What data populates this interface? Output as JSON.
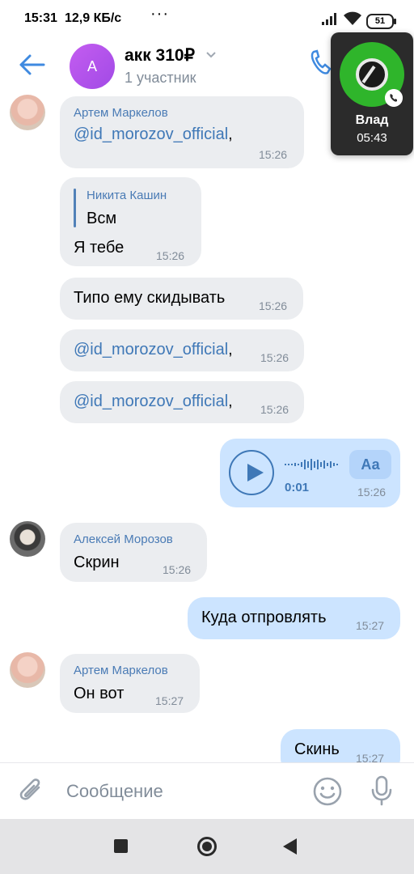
{
  "status": {
    "time": "15:31",
    "net_speed": "12,9 КБ/с",
    "battery": "51"
  },
  "header": {
    "back_icon": "arrow-left-icon",
    "avatar_letter": "А",
    "title": "акк 310₽",
    "subtitle": "1 участник",
    "call_icon": "phone-icon",
    "accent": "#3f8ae0"
  },
  "call_overlay": {
    "name": "Влад",
    "duration": "05:43"
  },
  "messages": [
    {
      "sender": "Артем Маркелов",
      "text": "@id_morozov_official",
      "trail": ",",
      "time": "15:26"
    },
    {
      "reply_to": {
        "name": "Никита Кашин",
        "text": "Всм"
      },
      "text": "Я тебе",
      "time": "15:26"
    },
    {
      "text": "Типо ему скидывать",
      "time": "15:26"
    },
    {
      "text": "@id_morozov_official",
      "trail": ",",
      "time": "15:26"
    },
    {
      "text": "@id_morozov_official",
      "trail": ",",
      "time": "15:26"
    },
    {
      "outgoing": true,
      "voice": {
        "duration": "0:01",
        "transcribe_label": "Аа"
      },
      "time": "15:26"
    },
    {
      "sender": "Алексей Морозов",
      "text": "Скрин",
      "time": "15:26"
    },
    {
      "outgoing": true,
      "text": "Куда отпровлять",
      "time": "15:27"
    },
    {
      "sender": "Артем Маркелов",
      "text": "Он вот",
      "time": "15:27"
    },
    {
      "outgoing": true,
      "text": "Скинь",
      "time": "15:27"
    }
  ],
  "composer": {
    "placeholder": "Сообщение",
    "attach_icon": "paperclip-icon",
    "emoji_icon": "smile-icon",
    "mic_icon": "microphone-icon"
  },
  "colors": {
    "incoming_bubble": "#ebedf0",
    "outgoing_bubble": "#cce4ff",
    "link": "#3f78b7",
    "sender": "#4a7bb5",
    "meta": "#818c99"
  }
}
